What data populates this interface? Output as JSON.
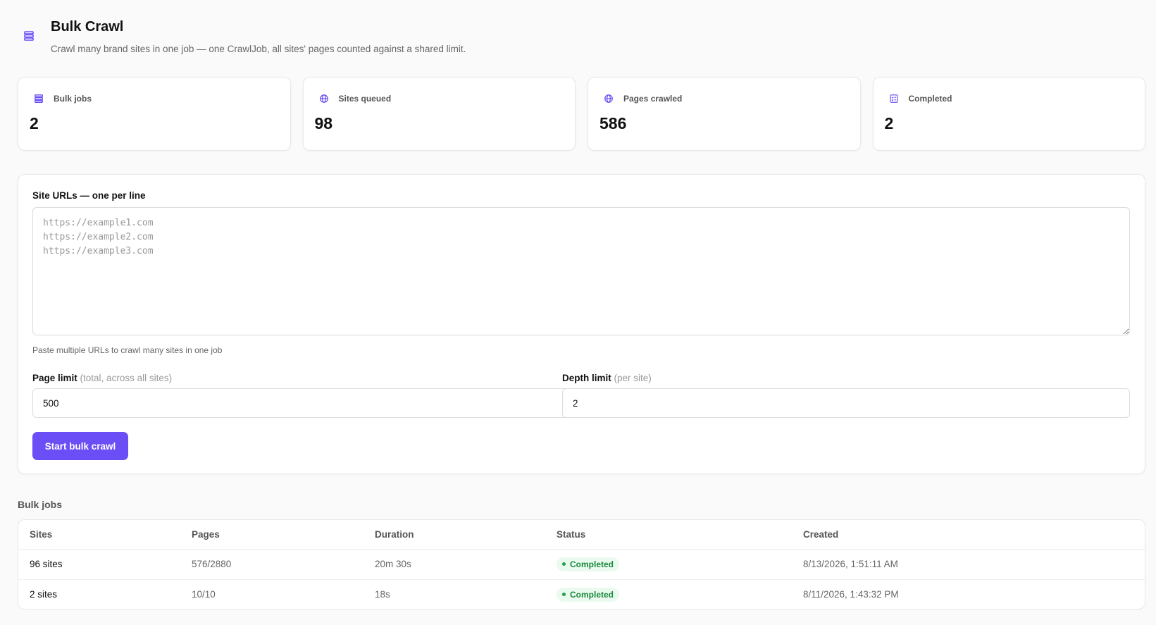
{
  "header": {
    "title": "Bulk Crawl",
    "subtitle": "Crawl many brand sites in one job — one CrawlJob, all sites' pages counted against a shared limit.",
    "icon": "stack-icon"
  },
  "stats": [
    {
      "label": "Bulk jobs",
      "value": "2",
      "icon": "stack-icon"
    },
    {
      "label": "Sites queued",
      "value": "98",
      "icon": "globe-icon"
    },
    {
      "label": "Pages crawled",
      "value": "586",
      "icon": "globe-icon"
    },
    {
      "label": "Completed",
      "value": "2",
      "icon": "checklist-icon"
    }
  ],
  "form": {
    "urls_label": "Site URLs — one per line",
    "urls_placeholder": "https://example1.com\nhttps://example2.com\nhttps://example3.com",
    "urls_value": "",
    "urls_help": "Paste multiple URLs to crawl many sites in one job",
    "page_limit_label": "Page limit",
    "page_limit_hint": "(total, across all sites)",
    "page_limit_value": "500",
    "depth_limit_label": "Depth limit",
    "depth_limit_hint": "(per site)",
    "depth_limit_value": "2",
    "start_button": "Start bulk crawl"
  },
  "jobs": {
    "title": "Bulk jobs",
    "columns": [
      "Sites",
      "Pages",
      "Duration",
      "Status",
      "Created"
    ],
    "rows": [
      {
        "sites": "96 sites",
        "pages": "576/2880",
        "duration": "20m 30s",
        "status": "Completed",
        "created": "8/13/2026, 1:51:11 AM"
      },
      {
        "sites": "2 sites",
        "pages": "10/10",
        "duration": "18s",
        "status": "Completed",
        "created": "8/11/2026, 1:43:32 PM"
      }
    ]
  },
  "colors": {
    "accent": "#6b4ef6",
    "success_bg": "#ebfaef",
    "success_text": "#1a8a3d"
  }
}
